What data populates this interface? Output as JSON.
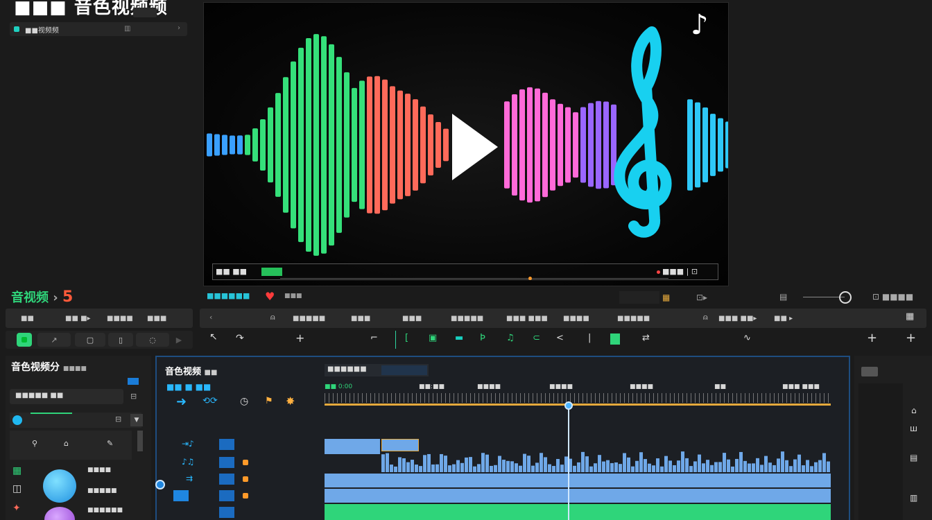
{
  "app": {
    "title": "■■■ 音色视频频",
    "sidebar_row": "■■视频频"
  },
  "preview": {
    "bar_label": "■■ ■■",
    "note_glyph": "♪",
    "clef_glyph": "𝄞",
    "play_glyph": "▶",
    "end_label": "■■■ | ⊡"
  },
  "brand": {
    "label": "音视频",
    "arrow": "›",
    "number": "5"
  },
  "toolbar_left": {
    "items": [
      "■■",
      "■■ ■▸",
      "■■■■",
      "■■■"
    ]
  },
  "toolbar_mid": {
    "items": [
      "■■■■■",
      "■■■",
      "■■■",
      "■■■■■",
      "■■■ ■■■",
      "■■■■",
      "■■■■■",
      "■■■ ■■▸",
      "■■ ▸"
    ],
    "label": "■■■■■■",
    "small_tag": "■■■"
  },
  "toolbar_right": {
    "items": [
      "■■ ■■",
      "■■■ ■■■■",
      "■■■■ ■■"
    ]
  },
  "left_panel": {
    "title": "音色视频分",
    "subtitle": "■■■■",
    "search_value": "■■■■■ ■■",
    "row_items": [
      "■■■■",
      "■■■■■",
      "■■■■■■"
    ]
  },
  "timeline": {
    "header": "音色视频",
    "header_sub": "■■",
    "label_row": "■■ ■ ■■",
    "field_label": "■■■■■■",
    "ruler": [
      "■■ 0:00",
      "■■:■■",
      "■■■■",
      "■■■■",
      "■■■■",
      "■■",
      "■■■ ■■■"
    ]
  },
  "colors": {
    "accent_green": "#2fd57a",
    "accent_blue": "#3aa0ff",
    "accent_cyan": "#18d0f0",
    "accent_red": "#ff5a4a",
    "accent_orange": "#ff8a3a",
    "playhead": "#cfe8ff"
  }
}
